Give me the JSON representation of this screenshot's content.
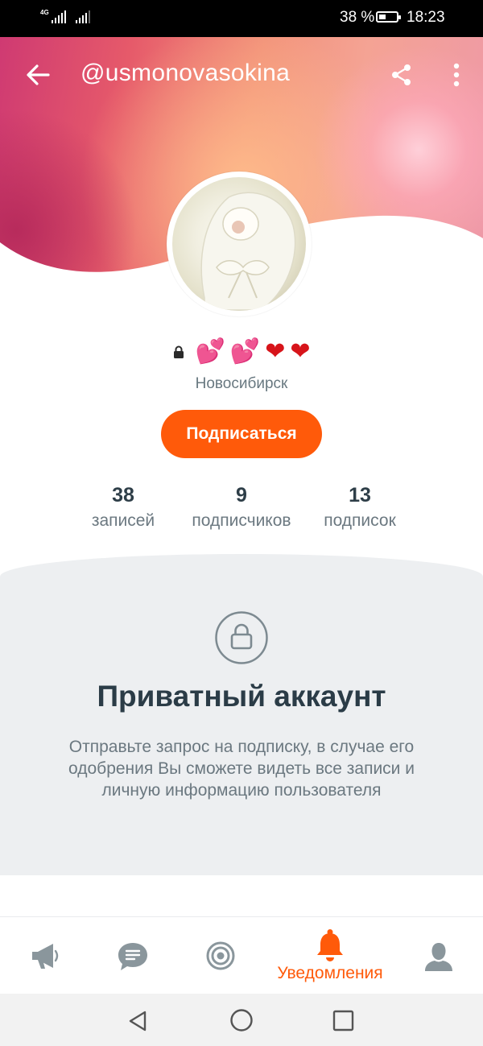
{
  "status_bar": {
    "network": "4G",
    "battery_text": "38 %",
    "battery_level": 0.38,
    "time": "18:23"
  },
  "header": {
    "handle": "@usmonovasokina"
  },
  "profile": {
    "name_icons": [
      "lock-icon",
      "two-hearts",
      "two-hearts",
      "red-heart",
      "red-heart"
    ],
    "hearts": [
      "💕",
      "💕",
      "❤",
      "❤"
    ],
    "city": "Новосибирск",
    "subscribe_label": "Подписаться"
  },
  "stats": [
    {
      "value": "38",
      "label": "записей"
    },
    {
      "value": "9",
      "label": "подписчиков"
    },
    {
      "value": "13",
      "label": "подписок"
    }
  ],
  "private": {
    "title": "Приватный аккаунт",
    "text": "Отправьте запрос на подписку, в случае его одобрения Вы сможете видеть все записи и личную информацию пользователя"
  },
  "bottom_nav": {
    "items": [
      {
        "icon": "megaphone-icon"
      },
      {
        "icon": "chat-icon"
      },
      {
        "icon": "target-icon"
      },
      {
        "icon": "bell-icon",
        "label": "Уведомления",
        "active": true
      },
      {
        "icon": "user-icon"
      }
    ]
  },
  "colors": {
    "accent": "#ff5a0a",
    "text_dark": "#2b3c47",
    "text_muted": "#6b7880",
    "icon_gray": "#8a969c",
    "section_bg": "#edeff1"
  }
}
